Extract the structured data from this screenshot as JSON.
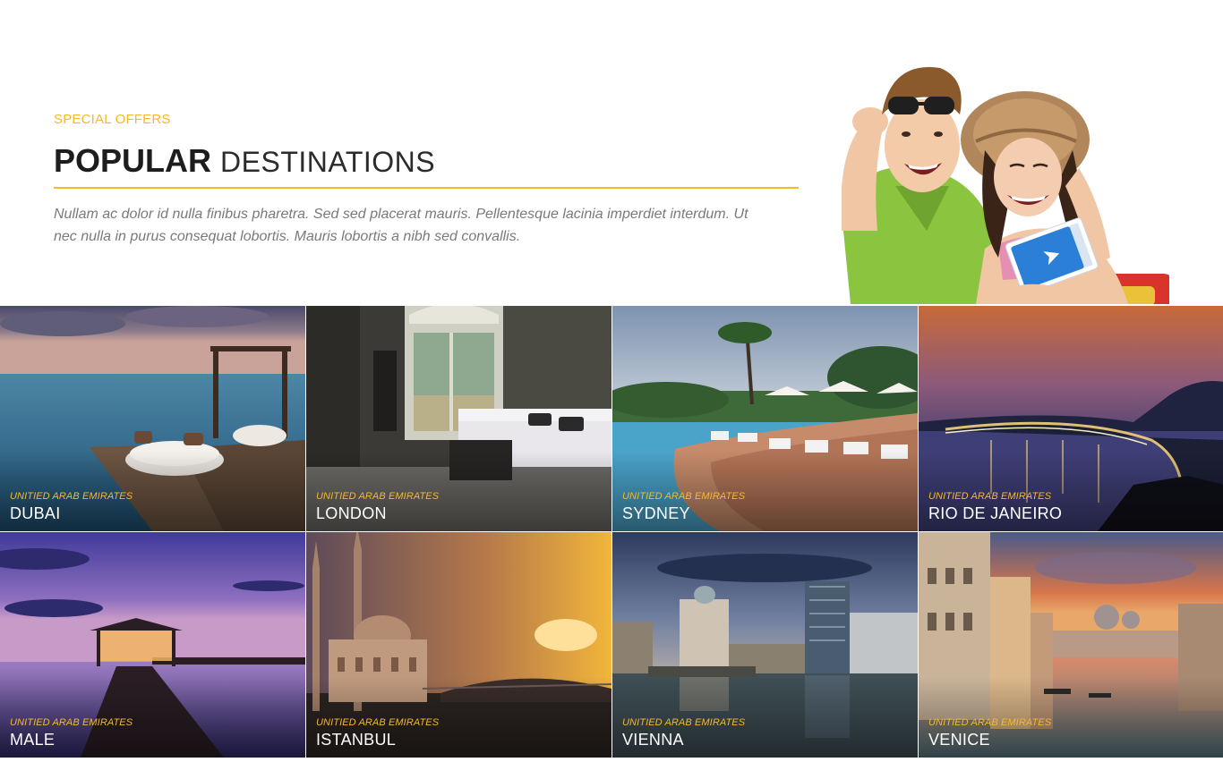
{
  "intro": {
    "eyebrow": "SPECIAL OFFERS",
    "title_bold": "POPULAR",
    "title_light": "DESTINATIONS",
    "lead": "Nullam ac dolor id nulla finibus pharetra. Sed sed placerat mauris. Pellentesque lacinia imperdiet interdum. Ut nec nulla in purus consequat lobortis. Mauris lobortis a nibh sed convallis."
  },
  "theme": {
    "accent": "#f5b82e",
    "heading": "#222222",
    "body_text": "#7a7a7a"
  },
  "destinations": [
    {
      "country": "UNITIED ARAB EMIRATES",
      "city": "DUBAI"
    },
    {
      "country": "UNITIED ARAB EMIRATES",
      "city": "LONDON"
    },
    {
      "country": "UNITIED ARAB EMIRATES",
      "city": "SYDNEY"
    },
    {
      "country": "UNITIED ARAB EMIRATES",
      "city": "RIO DE JANEIRO"
    },
    {
      "country": "UNITIED ARAB EMIRATES",
      "city": "MALE"
    },
    {
      "country": "UNITIED ARAB EMIRATES",
      "city": "ISTANBUL"
    },
    {
      "country": "UNITIED ARAB EMIRATES",
      "city": "VIENNA"
    },
    {
      "country": "UNITIED ARAB EMIRATES",
      "city": "VENICE"
    }
  ]
}
